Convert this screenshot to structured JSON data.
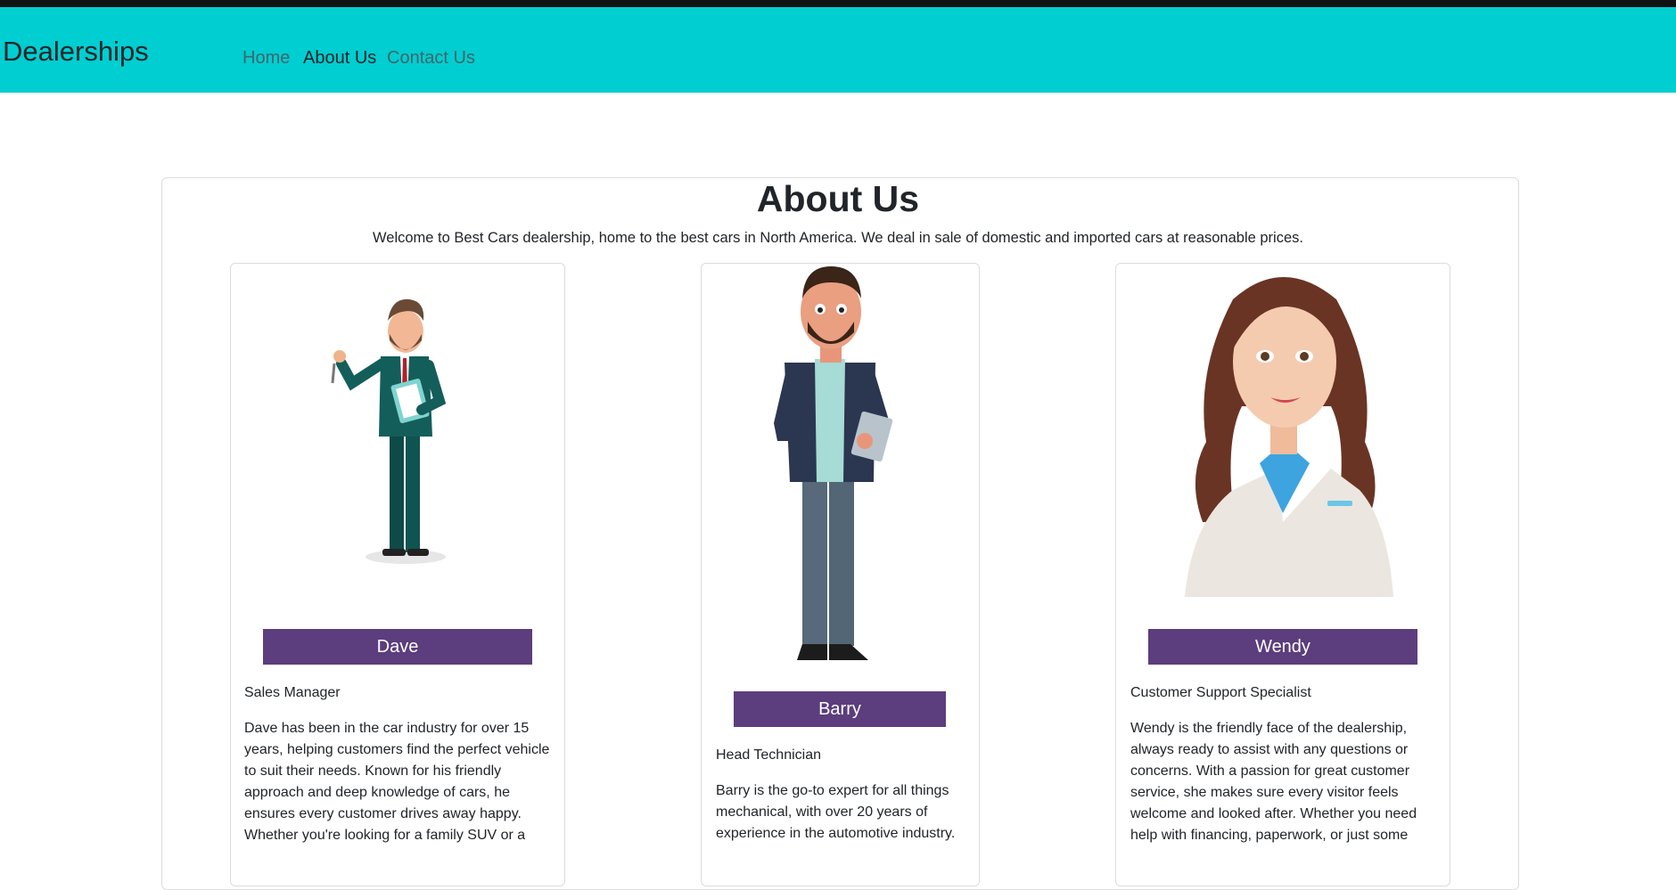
{
  "navbar": {
    "brand": "Dealerships",
    "links": [
      {
        "label": "Home"
      },
      {
        "label": "About Us"
      },
      {
        "label": "Contact Us"
      }
    ]
  },
  "page": {
    "title": "About Us",
    "intro": "Welcome to Best Cars dealership, home to the best cars in North America. We deal in sale of domestic and imported cars at reasonable prices."
  },
  "team": [
    {
      "name": "Dave",
      "role": "Sales Manager",
      "bio": "Dave has been in the car industry for over 15 years, helping customers find the perfect vehicle to suit their needs. Known for his friendly approach and deep knowledge of cars, he ensures every customer drives away happy. Whether you're looking for a family SUV or a"
    },
    {
      "name": "Barry",
      "role": "Head Technician",
      "bio": "Barry is the go-to expert for all things mechanical, with over 20 years of experience in the automotive industry."
    },
    {
      "name": "Wendy",
      "role": "Customer Support Specialist",
      "bio": "Wendy is the friendly face of the dealership, always ready to assist with any questions or concerns. With a passion for great customer service, she makes sure every visitor feels welcome and looked after. Whether you need help with financing, paperwork, or just some"
    }
  ],
  "colors": {
    "navbar": "#00ced1",
    "name_bar": "#5c3d7d"
  }
}
